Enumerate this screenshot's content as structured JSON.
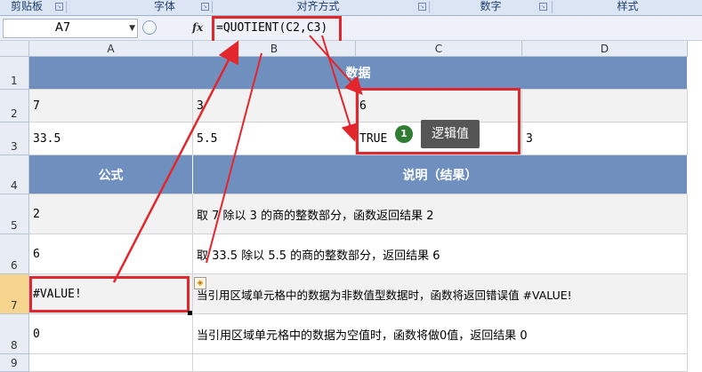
{
  "ribbon": {
    "groups": [
      "剪贴板",
      "字体",
      "对齐方式",
      "数字",
      "样式"
    ]
  },
  "formula_bar": {
    "name_box": "A7",
    "fx_label": "fx",
    "formula": "=QUOTIENT(C2,C3)"
  },
  "columns": [
    "A",
    "B",
    "C",
    "D"
  ],
  "rows": [
    "1",
    "2",
    "3",
    "4",
    "5",
    "6",
    "7",
    "8",
    "9"
  ],
  "sheet": {
    "r1_header": "数据",
    "r2": {
      "a": "7",
      "b": "3",
      "c": "6",
      "d": ""
    },
    "r3": {
      "a": "33.5",
      "b": "5.5",
      "c": "TRUE",
      "d": "3"
    },
    "r4": {
      "a": "公式",
      "b": "说明（结果）"
    },
    "r5": {
      "a": "2",
      "b": "取 7 除以 3 的商的整数部分，函数返回结果 2"
    },
    "r6": {
      "a": "6",
      "b": "取 33.5 除以 5.5 的商的整数部分，返回结果 6"
    },
    "r7": {
      "a": "#VALUE!",
      "b": "当引用区域单元格中的数据为非数值型数据时，函数将返回错误值 #VALUE!"
    },
    "r8": {
      "a": "0",
      "b": "当引用区域单元格中的数据为空值时，函数将做0值，返回结果 0"
    }
  },
  "annotation": {
    "badge": "1",
    "callout": "逻辑值"
  },
  "colors": {
    "header_fill": "#6f8fbf",
    "highlight": "#e3262c",
    "callout_bg": "#555555",
    "badge_green": "#2e7d32"
  }
}
